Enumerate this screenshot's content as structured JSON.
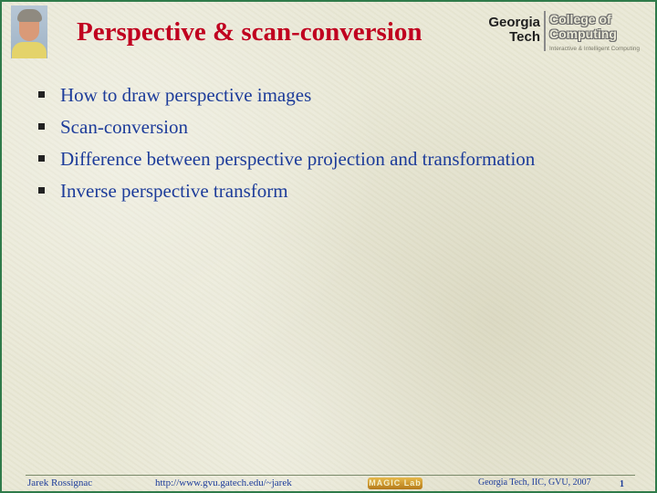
{
  "slide": {
    "title": "Perspective & scan-conversion",
    "bullets": [
      "How to draw perspective images",
      "Scan-conversion",
      "Difference between perspective projection and transformation",
      "Inverse perspective transform"
    ]
  },
  "logo": {
    "line1": "Georgia",
    "line2": "Tech",
    "college1": "College of",
    "college2": "Computing",
    "tagline": "Interactive & Intelligent Computing"
  },
  "footer": {
    "author": "Jarek Rossignac",
    "url": "http://www.gvu.gatech.edu/~jarek",
    "badge": "MAGIC Lab",
    "affiliation": "Georgia Tech, IIC, GVU, 2007",
    "page": "1"
  },
  "colors": {
    "title": "#c0001f",
    "body_text": "#1d3c9a",
    "border": "#2f7b4a"
  }
}
